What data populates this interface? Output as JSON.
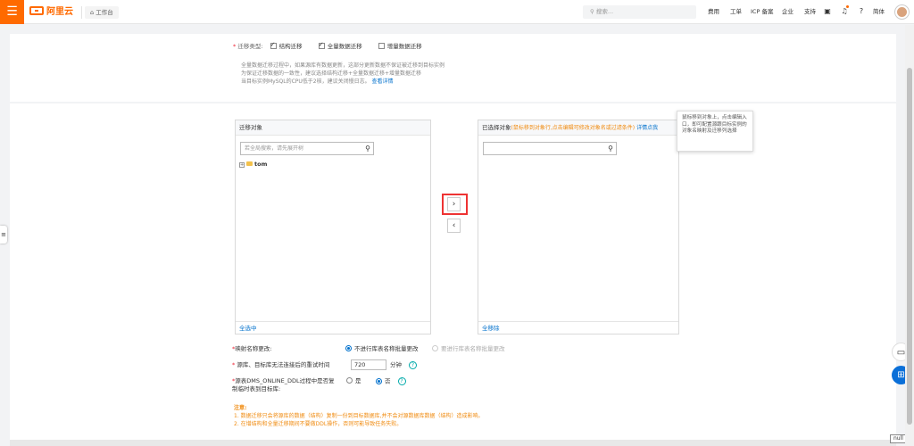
{
  "topbar": {
    "logo_text": "阿里云",
    "workbench_label": "工作台",
    "search_placeholder": "搜索...",
    "nav": [
      "费用",
      "工单",
      "ICP 备案",
      "企业",
      "支持"
    ],
    "lang": "简体"
  },
  "migration": {
    "type_label": "迁移类型:",
    "options": [
      {
        "label": "结构迁移",
        "checked": true
      },
      {
        "label": "全量数据迁移",
        "checked": true
      },
      {
        "label": "增量数据迁移",
        "checked": false
      }
    ],
    "note_lines": [
      "全量数据迁移过程中，如果源库有数据更新，这部分更新数据不保证被迁移到目标实例",
      "为保证迁移数据的一致性，建议选择结构迁移+全量数据迁移+增量数据迁移",
      "当目标实例MySQL的CPU低于2核，建议关闭慢日志。"
    ],
    "note_link": "查看详情"
  },
  "source_box": {
    "title": "迁移对象",
    "search_placeholder": "若全局搜索，请先展开树",
    "tree_item": "tom",
    "footer": "全选中"
  },
  "target_box": {
    "title": "已选择对象",
    "hint": "(鼠标移到对象行,点击编辑可修改对象名或过滤条件)",
    "hint_link": "详情点我",
    "footer": "全移除"
  },
  "tooltip": {
    "text": "鼠标移到对象上，点击编辑入口，即可配置源跟目标实例的对象名映射及迁移列选择"
  },
  "buttons": {
    "move_right": "›",
    "move_left": "‹"
  },
  "form": {
    "rename_label": "映射名称更改:",
    "rename_option_no": "不进行库表名称批量更改",
    "rename_option_yes": "要进行库表名称批量更改",
    "retry_label": "源库、目标库无法连接后的重试时间",
    "retry_value": "720",
    "retry_unit": "分钟",
    "ddl_label_line1": "源表DMS_ONLINE_DDL过程中是否复",
    "ddl_label_line2": "制临时表到目标库:",
    "ddl_yes": "是",
    "ddl_no": "否"
  },
  "notes": {
    "title": "注意:",
    "lines": [
      "1. 数据迁移只会将源库的数据（结构）复制一份到目标数据库,并不会对源数据库数据（结构）造成影响。",
      "2. 在增结构和全量迁移期间不要做DDL操作，否则可能导致任务失败。"
    ]
  },
  "misc": {
    "null_label": "null"
  },
  "colors": {
    "brand": "#ff6a00",
    "link": "#0070cc",
    "warning": "#f08b10",
    "highlight": "#e33333"
  }
}
